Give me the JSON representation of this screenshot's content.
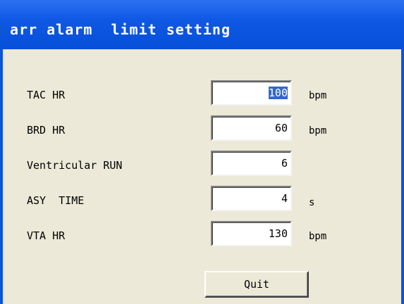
{
  "window": {
    "title": "arr alarm  limit setting"
  },
  "rows": [
    {
      "label": "TAC HR",
      "value": "100",
      "unit": "bpm",
      "selected": true
    },
    {
      "label": "BRD HR",
      "value": "60",
      "unit": "bpm"
    },
    {
      "label": "Ventricular RUN",
      "value": "6",
      "unit": ""
    },
    {
      "label": "ASY  TIME",
      "value": "4",
      "unit": "s"
    },
    {
      "label": "VTA HR",
      "value": "130",
      "unit": "bpm"
    }
  ],
  "buttons": {
    "quit_label": "Quit"
  },
  "colors": {
    "titlebar": "#0a54e0",
    "client_bg": "#ece9d8",
    "selection": "#316ac5"
  }
}
